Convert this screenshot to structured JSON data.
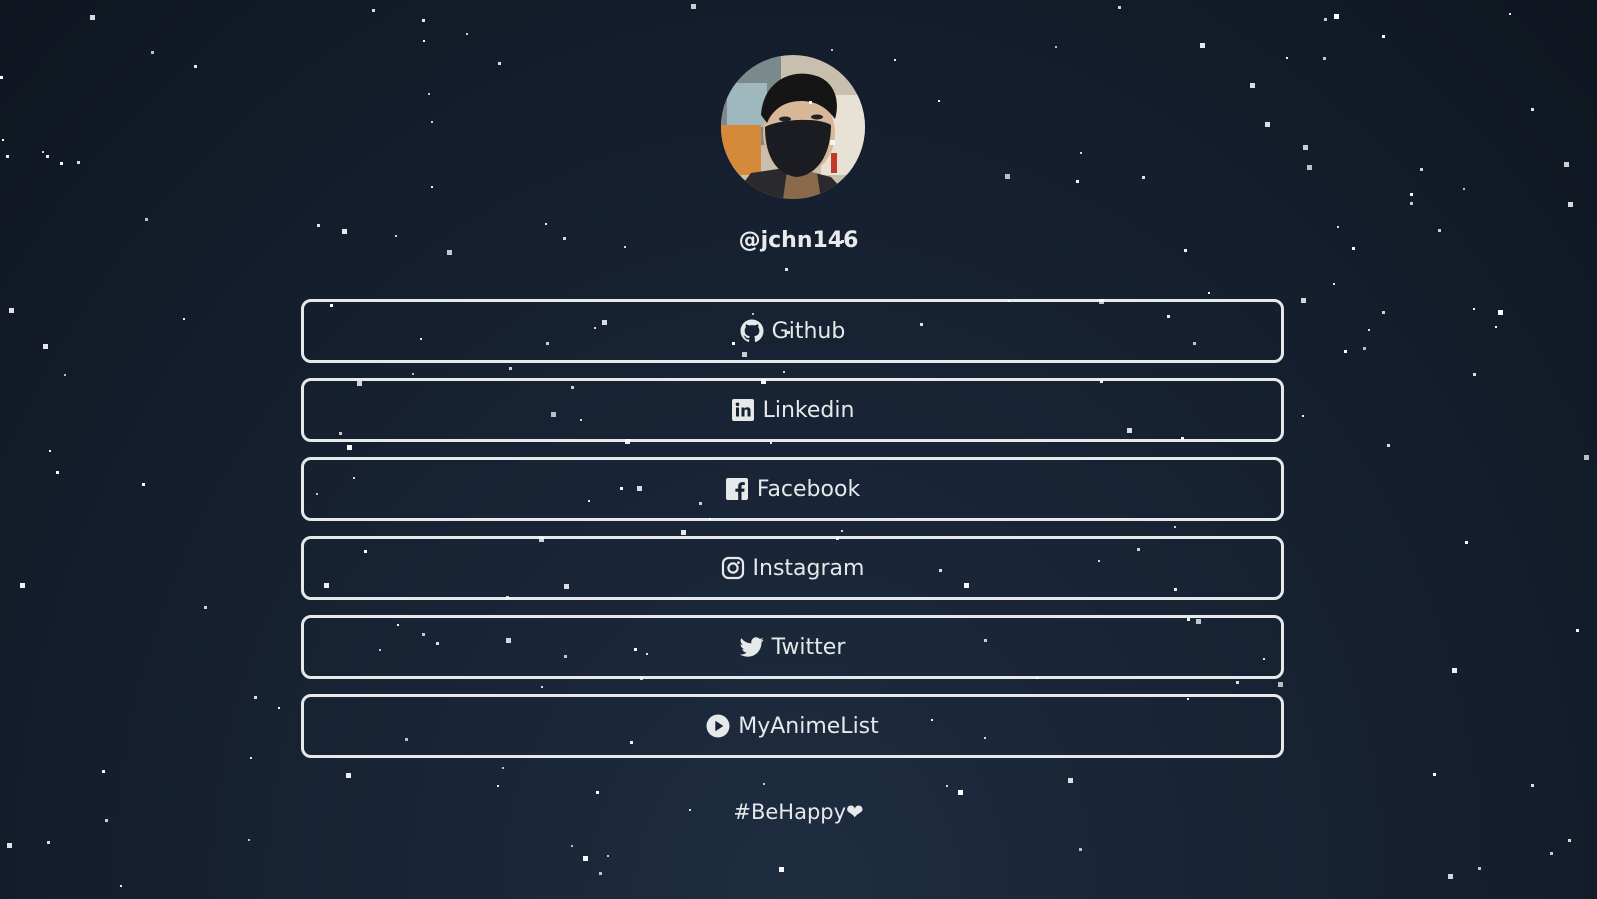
{
  "profile": {
    "username": "@jchn146",
    "avatar_alt": "profile photo of person wearing black face mask"
  },
  "links": [
    {
      "label": "Github",
      "icon": "github-icon"
    },
    {
      "label": "Linkedin",
      "icon": "linkedin-icon"
    },
    {
      "label": "Facebook",
      "icon": "facebook-icon"
    },
    {
      "label": "Instagram",
      "icon": "instagram-icon"
    },
    {
      "label": "Twitter",
      "icon": "twitter-icon"
    },
    {
      "label": "MyAnimeList",
      "icon": "play-circle-icon"
    }
  ],
  "footer": {
    "tagline": "#BeHappy❤"
  },
  "theme": {
    "background_dark": "#0f1620",
    "background_light": "#1e2d40",
    "foreground": "#e6e8ea",
    "star": "#ffffff"
  }
}
